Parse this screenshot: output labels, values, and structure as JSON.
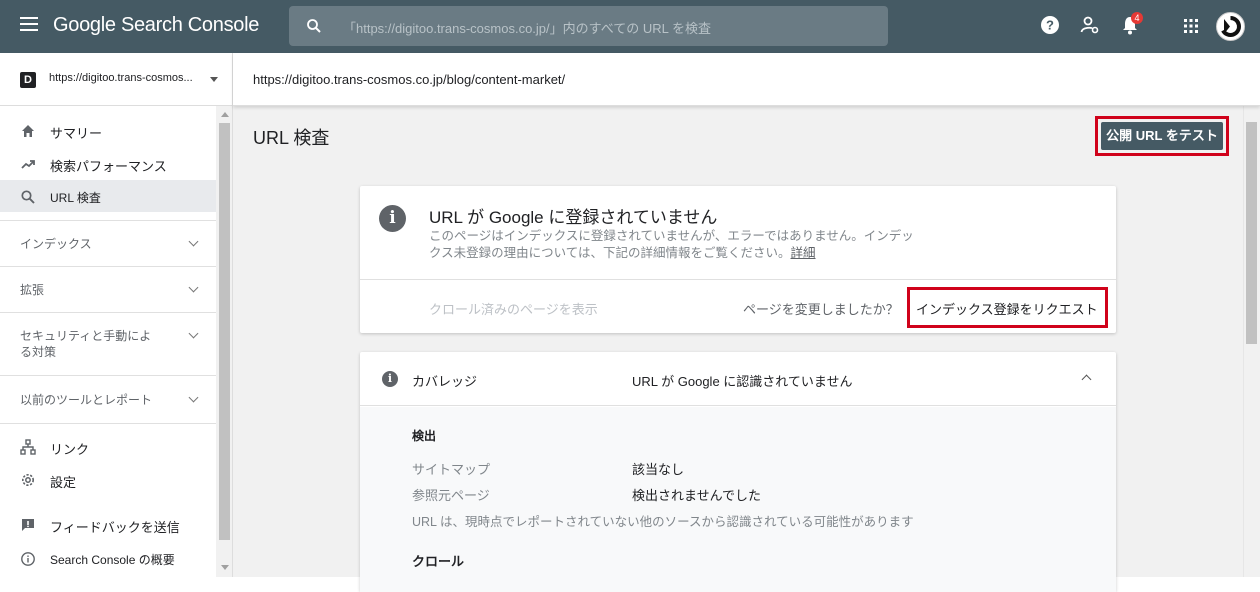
{
  "header": {
    "app_title": "Google Search Console",
    "search_placeholder": "「https://digitoo.trans-cosmos.co.jp/」内のすべての URL を検査",
    "notification_count": "4"
  },
  "property": {
    "name": "https://digitoo.trans-cosmos..."
  },
  "url_bar": {
    "url": "https://digitoo.trans-cosmos.co.jp/blog/content-market/"
  },
  "sidebar": {
    "items": [
      {
        "label": "サマリー",
        "icon": "home-icon"
      },
      {
        "label": "検索パフォーマンス",
        "icon": "trending-up-icon"
      },
      {
        "label": "URL 検査",
        "icon": "search-icon"
      }
    ],
    "sections": [
      {
        "label": "インデックス"
      },
      {
        "label": "拡張"
      },
      {
        "label": "セキュリティと手動による対策"
      },
      {
        "label": "以前のツールとレポート"
      }
    ],
    "bottom_items": [
      {
        "label": "リンク",
        "icon": "links-icon"
      },
      {
        "label": "設定",
        "icon": "gear-icon"
      },
      {
        "label": "フィードバックを送信",
        "icon": "feedback-icon"
      },
      {
        "label": "Search Console の概要",
        "icon": "info-icon"
      }
    ]
  },
  "main": {
    "page_title": "URL 検査",
    "test_button": "公開 URL をテスト",
    "status_card": {
      "title": "URL が Google に登録されていません",
      "desc": "このページはインデックスに登録されていませんが、エラーではありません。インデックス未登録の理由については、下記の詳細情報をご覧ください。",
      "detail_link": "詳細",
      "crawled_link": "クロール済みのページを表示",
      "changed_text": "ページを変更しましたか？",
      "request_button": "インデックス登録をリクエスト"
    },
    "coverage": {
      "label": "カバレッジ",
      "value": "URL が Google に認識されていません",
      "discovery_heading": "検出",
      "rows": [
        {
          "key": "サイトマップ",
          "value": "該当なし"
        },
        {
          "key": "参照元ページ",
          "value": "検出されませんでした"
        }
      ],
      "note": "URL は、現時点でレポートされていない他のソースから認識されている可能性があります",
      "crawl_heading": "クロール"
    }
  }
}
